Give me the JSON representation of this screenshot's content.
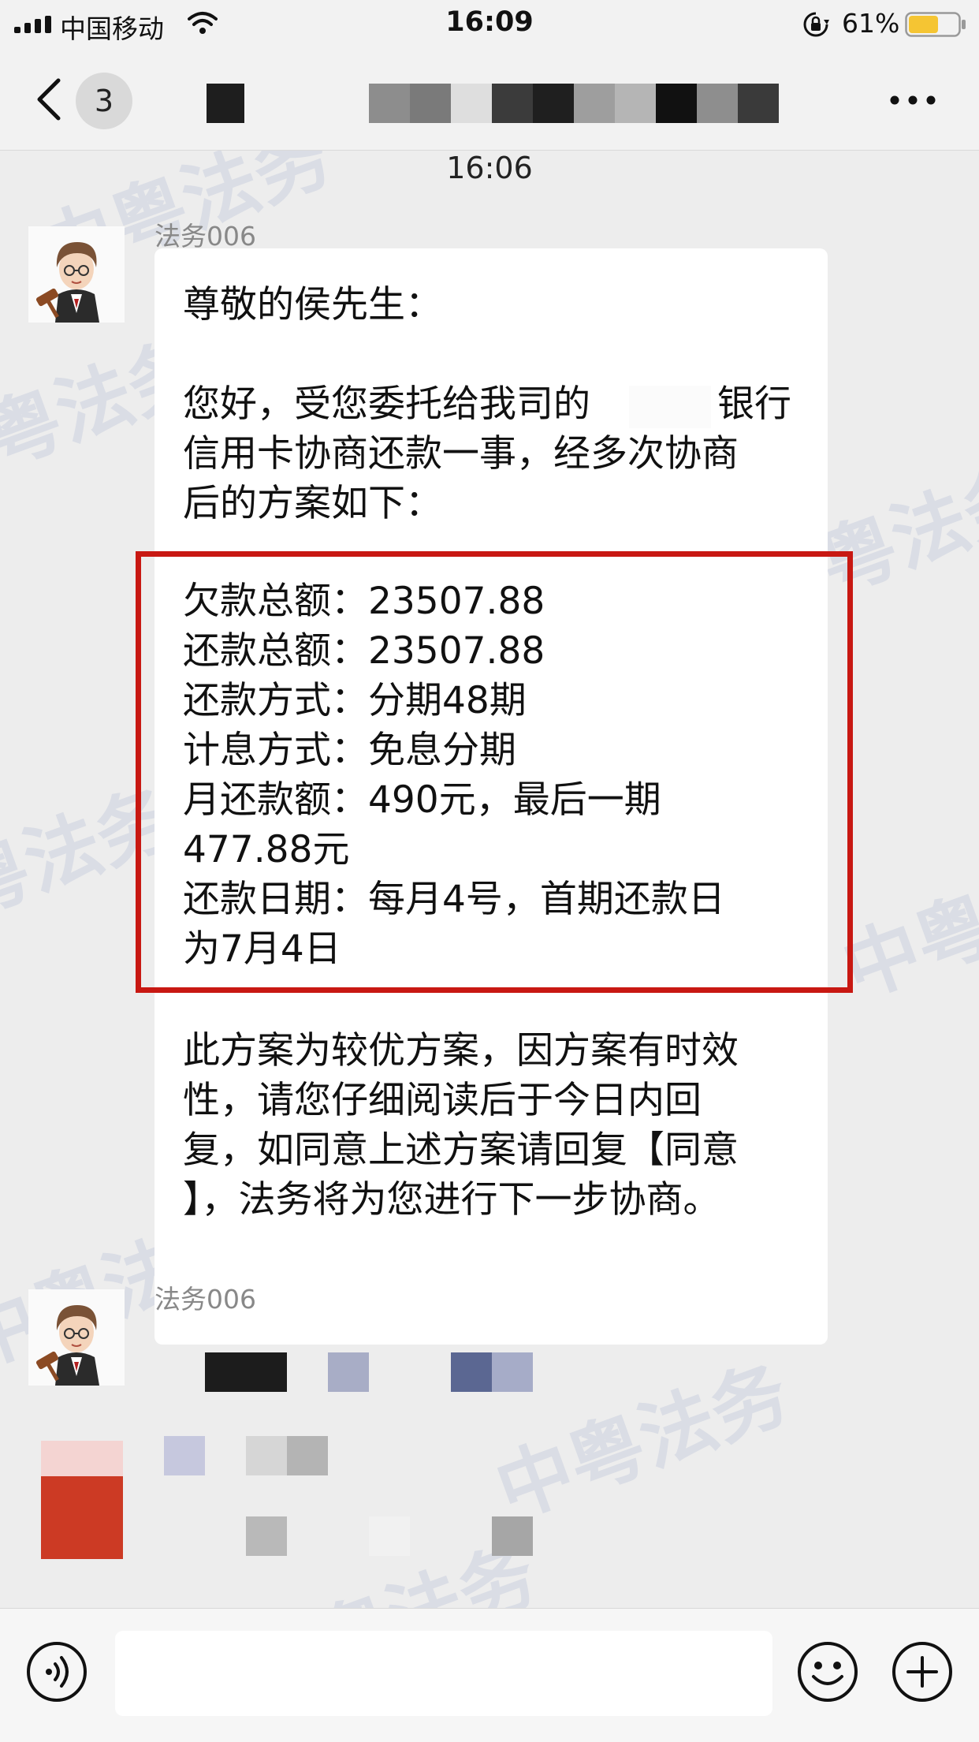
{
  "status_bar": {
    "carrier": "中国移动",
    "time": "16:09",
    "battery_percent": "61%",
    "battery_level": 0.61,
    "icons": [
      "signal-icon",
      "wifi-icon",
      "orientation-lock-icon",
      "battery-icon"
    ]
  },
  "nav": {
    "back_icon": "chevron-left-icon",
    "unread_count": "3",
    "more_icon": "ellipsis-icon"
  },
  "chat": {
    "time_divider": "16:06",
    "messages": [
      {
        "sender": "法务006",
        "greeting": "尊敬的侯先生：",
        "intro": [
          "您好，受您委托给我司的",
          "银行",
          "信用卡协商还款一事，经多次协商",
          "后的方案如下："
        ],
        "plan_lines": [
          "欠款总额：23507.88",
          "还款总额：23507.88",
          "还款方式：分期48期",
          "计息方式：免息分期",
          "月还款额：490元，最后一期",
          "477.88元",
          "还款日期：每月4号，首期还款日",
          "为7月4日"
        ],
        "closing": [
          "此方案为较优方案，因方案有时效",
          "性，请您仔细阅读后于今日内回",
          "复，如同意上述方案请回复【同意",
          "】，法务将为您进行下一步协商。"
        ]
      },
      {
        "sender": "法务006"
      }
    ],
    "watermark_text": "中粤法务"
  },
  "input_bar": {
    "icons": [
      "voice-icon",
      "emoji-icon",
      "plus-icon"
    ]
  },
  "colors": {
    "highlight_border": "#c81812",
    "background": "#ededed"
  }
}
